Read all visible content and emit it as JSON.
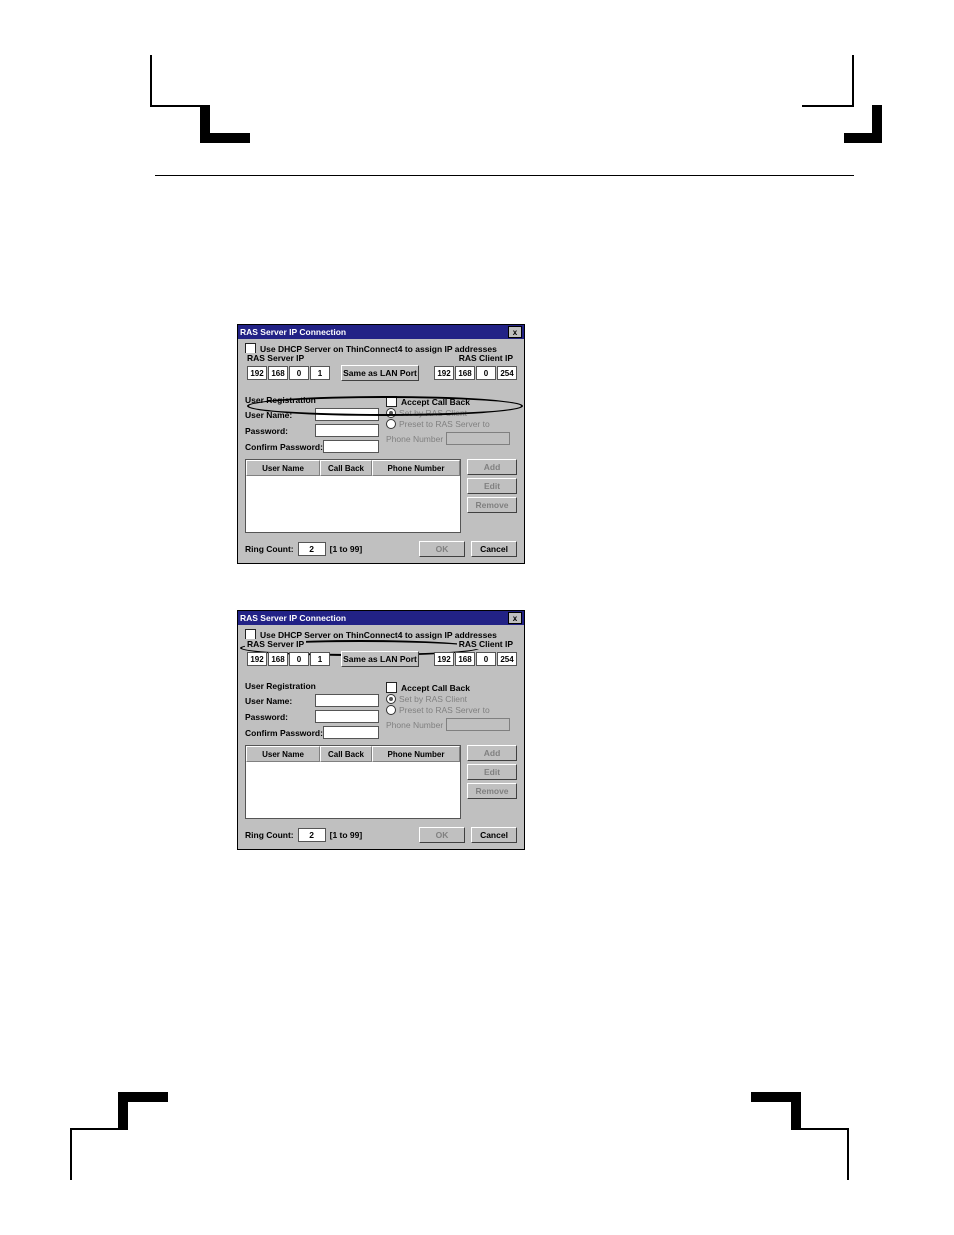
{
  "dialog": {
    "title": "RAS Server IP Connection",
    "dhcp_label": "Use DHCP Server on ThinConnect4 to assign IP addresses",
    "server_ip_label": "RAS Server IP",
    "client_ip_label": "RAS Client IP",
    "server_ip": [
      "192",
      "168",
      "0",
      "1"
    ],
    "client_ip": [
      "192",
      "168",
      "0",
      "254"
    ],
    "same_as_lan": "Same as LAN Port",
    "user_reg_label": "User Registration",
    "user_name_label": "User Name:",
    "password_label": "Password:",
    "confirm_pw_label": "Confirm Password:",
    "accept_callback": "Accept Call Back",
    "set_by_client": "Set by RAS Client",
    "preset_server": "Preset to RAS Server to",
    "phone_number_label": "Phone Number",
    "table": {
      "h1": "User Name",
      "h2": "Call Back",
      "h3": "Phone Number"
    },
    "btn": {
      "add": "Add",
      "edit": "Edit",
      "remove": "Remove",
      "ok": "OK",
      "cancel": "Cancel"
    },
    "ring_count_label": "Ring Count:",
    "ring_count_value": "2",
    "ring_range": "[1 to 99]"
  }
}
